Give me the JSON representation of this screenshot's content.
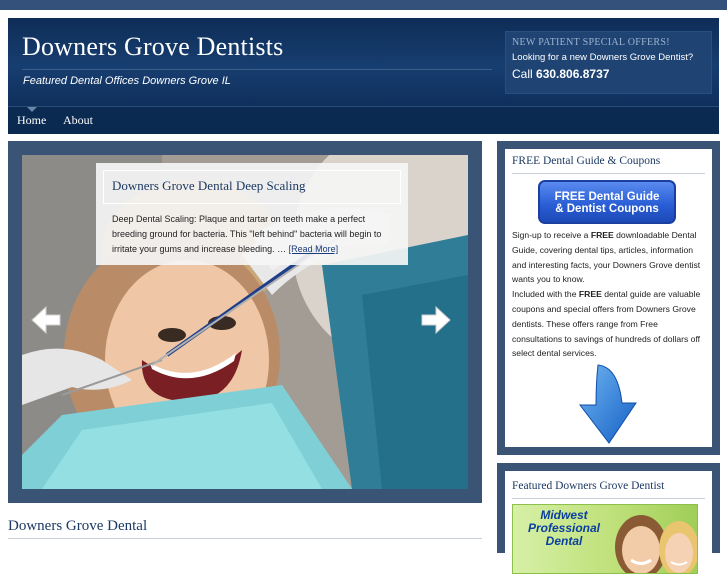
{
  "header": {
    "site_title": "Downers Grove Dentists",
    "tagline": "Featured Dental Offices Downers Grove IL",
    "offer_title": "NEW PATIENT SPECIAL OFFERS!",
    "offer_text": "Looking for a new Downers Grove Dentist?",
    "call_label": "Call",
    "phone": "630.806.8737"
  },
  "nav": {
    "items": [
      {
        "label": "Home"
      },
      {
        "label": "About"
      }
    ]
  },
  "slider": {
    "title": "Downers Grove Dental Deep Scaling",
    "text": "Deep Dental Scaling: Plaque and tartar on teeth make a perfect breeding ground for bacteria.  This \"left behind\" bacteria will begin to irritate your gums and increase bleeding. …",
    "read_more": "[Read More]",
    "prev_icon": "arrow-left-icon",
    "next_icon": "arrow-right-icon"
  },
  "content": {
    "section_title": "Downers Grove Dental"
  },
  "sidebar": {
    "guide": {
      "title": "FREE Dental Guide & Coupons",
      "button_line1": "FREE Dental Guide",
      "button_line2": "& Dentist Coupons",
      "p1_pre": "Sign-up to receive a ",
      "p1_bold": "FREE",
      "p1_post": " downloadable Dental Guide, covering dental tips, articles, information and interesting facts, your Downers Grove dentist wants you to know.",
      "p2_pre": "Included with the ",
      "p2_bold": "FREE",
      "p2_post": " dental guide are valuable coupons and special offers from Downers Grove dentists. These offers range from Free consultations to savings of hundreds of dollars off select dental services.",
      "arrow_icon": "down-arrow-icon"
    },
    "featured": {
      "title": "Featured Downers Grove Dentist",
      "ad_line1": "Midwest",
      "ad_line2": "Professional",
      "ad_line3": "Dental"
    }
  },
  "colors": {
    "header_bg": "#0e2d57",
    "frame": "#3a5475",
    "title_text": "#1c3a63",
    "button_blue": "#2a5fd6",
    "arrow_blue": "#1a6fd0"
  }
}
